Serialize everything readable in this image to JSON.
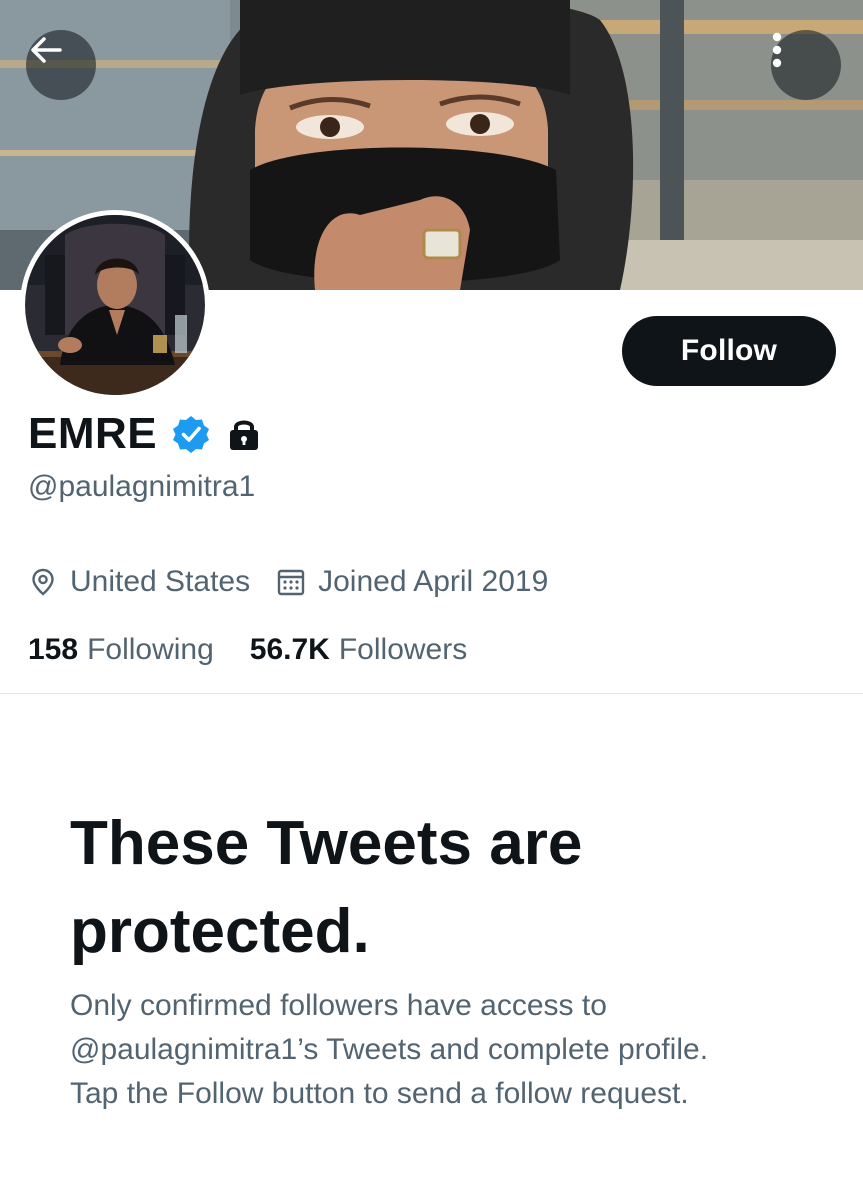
{
  "profile": {
    "display_name": "EMRE",
    "handle": "@paulagnimitra1",
    "location": "United States",
    "joined": "Joined April 2019",
    "following_count": "158",
    "following_label": "Following",
    "followers_count": "56.7K",
    "followers_label": "Followers",
    "verified": true,
    "protected": true
  },
  "header": {
    "back_icon": "arrow-left-icon",
    "more_icon": "more-vertical-icon",
    "follow_label": "Follow"
  },
  "icons": {
    "verified": "verified-badge-icon",
    "lock": "lock-icon",
    "location": "location-pin-icon",
    "calendar": "calendar-icon"
  },
  "protected_notice": {
    "title_line1": "These Tweets are",
    "title_line2": "protected.",
    "body_line1": "Only confirmed followers have access to",
    "body_line2": "@paulagnimitra1’s Tweets and complete profile.",
    "body_line3": "Tap the Follow button to send a follow request."
  },
  "colors": {
    "text_primary": "#0f1419",
    "text_secondary": "#536471",
    "verified_blue": "#1d9bf0",
    "follow_button_bg": "#0f1419",
    "divider": "#e1e6ea"
  }
}
